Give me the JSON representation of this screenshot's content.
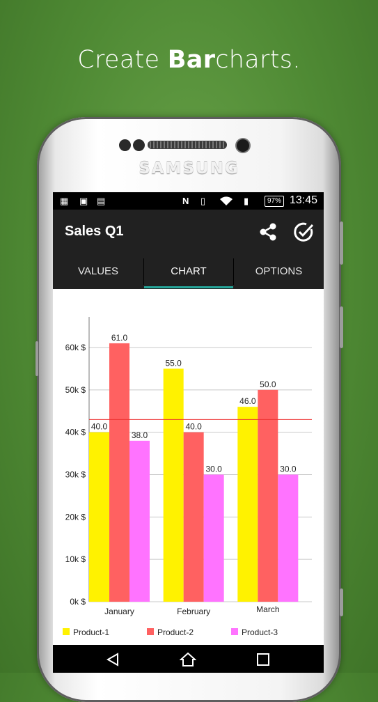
{
  "headline": {
    "prefix": "Create ",
    "bold": "Bar",
    "suffix": "charts."
  },
  "device": {
    "brand": "SAMSUNG"
  },
  "status_bar": {
    "battery": "97%",
    "time": "13:45"
  },
  "app": {
    "title": "Sales Q1"
  },
  "tabs": [
    {
      "label": "VALUES",
      "active": false
    },
    {
      "label": "CHART",
      "active": true
    },
    {
      "label": "OPTIONS",
      "active": false
    }
  ],
  "icons": [
    "share-icon",
    "check-circle-icon",
    "back-icon",
    "home-icon",
    "recents-icon"
  ],
  "colors": {
    "appbar": "#212121",
    "tab_indicator": "#26a69a",
    "product1": "#fff200",
    "product2": "#ff6161",
    "product3": "#ff73ff",
    "limit_line": "#ee3333"
  },
  "chart_data": {
    "type": "bar",
    "categories": [
      "January",
      "February",
      "March"
    ],
    "series": [
      {
        "name": "Product-1",
        "values": [
          40.0,
          55.0,
          46.0
        ]
      },
      {
        "name": "Product-2",
        "values": [
          61.0,
          40.0,
          50.0
        ]
      },
      {
        "name": "Product-3",
        "values": [
          38.0,
          30.0,
          30.0
        ]
      }
    ],
    "value_labels": [
      [
        "40.0",
        "55.0",
        "46.0"
      ],
      [
        "61.0",
        "40.0",
        "50.0"
      ],
      [
        "38.0",
        "30.0",
        "30.0"
      ]
    ],
    "y_ticks": [
      "0k $",
      "10k $",
      "20k $",
      "30k $",
      "40k $",
      "50k $",
      "60k $"
    ],
    "ylim": [
      0,
      60
    ],
    "limit_line": 43,
    "grid": true,
    "legend": "bottom"
  }
}
